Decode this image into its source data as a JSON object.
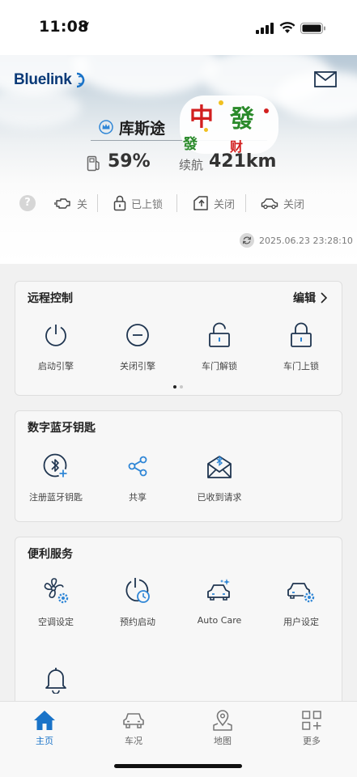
{
  "status_bar": {
    "time": "11:08"
  },
  "header": {
    "brand": "Bluelink",
    "car_name": "库斯途",
    "sticker_chars": [
      "中",
      "發",
      "發",
      "财"
    ],
    "fuel": "59%",
    "range_label": "续航",
    "range": "421km",
    "statuses": [
      {
        "icon": "engine-icon",
        "label": "关"
      },
      {
        "icon": "lock-icon",
        "label": "已上锁"
      },
      {
        "icon": "window-icon",
        "label": "关闭"
      },
      {
        "icon": "car-door-icon",
        "label": "关闭"
      }
    ],
    "updated_at": "2025.06.23 23:28:10"
  },
  "remote_control": {
    "title": "远程控制",
    "edit_label": "编辑",
    "items": [
      {
        "icon": "power-icon",
        "label": "启动引擎"
      },
      {
        "icon": "minus-circle-icon",
        "label": "关闭引擎"
      },
      {
        "icon": "unlock-icon",
        "label": "车门解锁"
      },
      {
        "icon": "lock-icon",
        "label": "车门上锁"
      }
    ],
    "page_count": 2,
    "active_page": 1
  },
  "digital_key": {
    "title": "数字蓝牙钥匙",
    "items": [
      {
        "icon": "bluetooth-add-icon",
        "label": "注册蓝牙钥匙"
      },
      {
        "icon": "share-icon",
        "label": "共享"
      },
      {
        "icon": "envelope-bluetooth-icon",
        "label": "已收到请求"
      }
    ]
  },
  "services": {
    "title": "便利服务",
    "items": [
      {
        "icon": "fan-gear-icon",
        "label": "空调设定"
      },
      {
        "icon": "power-clock-icon",
        "label": "预约启动"
      },
      {
        "icon": "car-sparkle-icon",
        "label": "Auto Care"
      },
      {
        "icon": "car-gear-icon",
        "label": "用户设定"
      },
      {
        "icon": "bell-icon",
        "label": ""
      }
    ]
  },
  "tabs": [
    {
      "icon": "home-icon",
      "label": "主页",
      "active": true
    },
    {
      "icon": "car-icon",
      "label": "车况",
      "active": false
    },
    {
      "icon": "map-pin-icon",
      "label": "地图",
      "active": false
    },
    {
      "icon": "grid-plus-icon",
      "label": "更多",
      "active": false
    }
  ],
  "colors": {
    "accent": "#1a73c8",
    "brand": "#0a3a78",
    "icon_dark": "#1f3550",
    "icon_blue": "#2f86d6"
  }
}
